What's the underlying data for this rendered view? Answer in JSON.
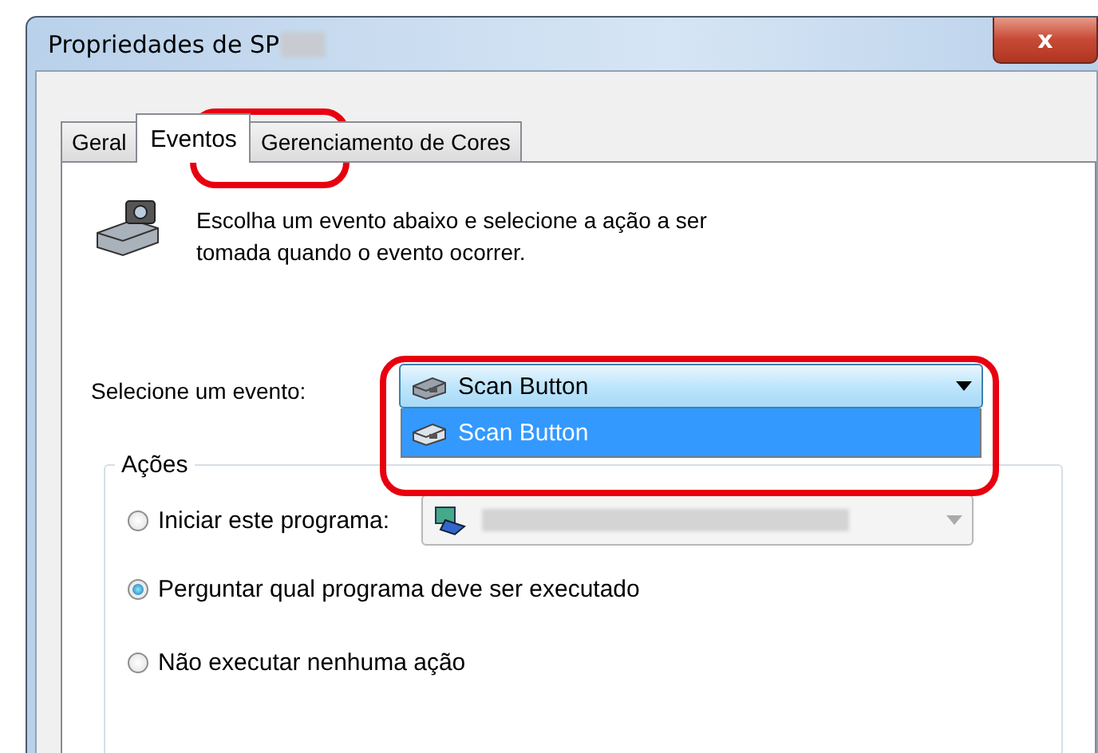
{
  "window": {
    "title": "Propriedades de SP",
    "close": "x"
  },
  "tabs": [
    {
      "label": "Geral",
      "selected": false,
      "highlighted": false
    },
    {
      "label": "Eventos",
      "selected": true,
      "highlighted": true
    },
    {
      "label": "Gerenciamento de Cores",
      "selected": false,
      "highlighted": false
    }
  ],
  "intro": "Escolha um evento abaixo e selecione a ação a ser tomada quando o evento ocorrer.",
  "event": {
    "label": "Selecione um evento:",
    "value": "Scan Button",
    "expanded": true,
    "highlighted": true,
    "options": [
      {
        "label": "Scan Button",
        "selected": true
      }
    ]
  },
  "actions": {
    "title": "Ações",
    "options": [
      {
        "label": "Iniciar este programa:",
        "selected": false,
        "kind": "program"
      },
      {
        "label": "Perguntar qual programa deve ser executado",
        "selected": true,
        "kind": "plain"
      },
      {
        "label": "Não executar nenhuma ação",
        "selected": false,
        "kind": "plain"
      }
    ]
  }
}
